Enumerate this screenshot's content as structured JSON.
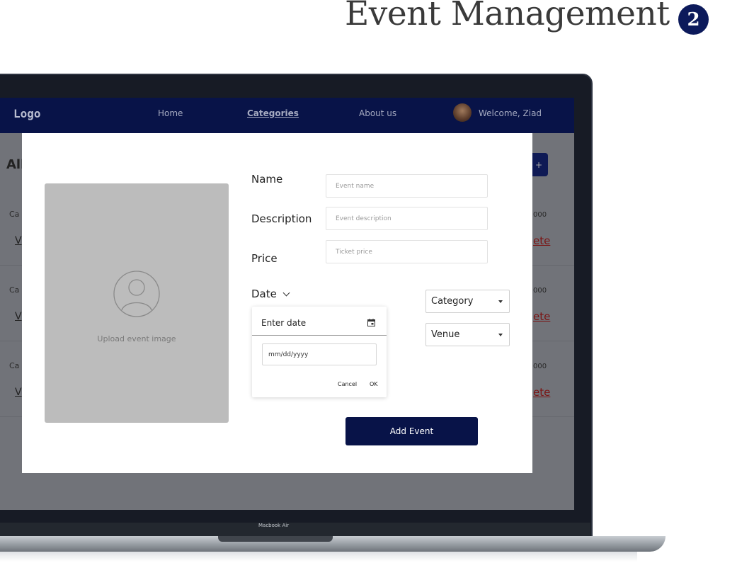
{
  "header": {
    "title": "Event Management",
    "step_number": "2"
  },
  "laptop": {
    "model_label": "Macbook Air"
  },
  "nav": {
    "logo": "Logo",
    "links": [
      {
        "label": "Home",
        "active": false
      },
      {
        "label": "Categories",
        "active": true
      },
      {
        "label": "About us",
        "active": false
      }
    ],
    "welcome": "Welcome, Ziad"
  },
  "background_page": {
    "title_fragment": "All",
    "add_button_fragment": "+",
    "rows": [
      {
        "left_label": "Ca",
        "left_link": "V",
        "right_value": "000",
        "right_link": "ete"
      },
      {
        "left_label": "Ca",
        "left_link": "V",
        "right_value": "000",
        "right_link": "ete"
      },
      {
        "left_label": "Ca",
        "left_link": "V",
        "right_value": "000",
        "right_link": "ete"
      }
    ]
  },
  "modal": {
    "upload": {
      "label": "Upload event image"
    },
    "fields": {
      "name": {
        "label": "Name",
        "placeholder": "Event name",
        "value": ""
      },
      "description": {
        "label": "Description",
        "placeholder": "Event description",
        "value": ""
      },
      "price": {
        "label": "Price",
        "placeholder": "Ticket price",
        "value": ""
      }
    },
    "date": {
      "label": "Date",
      "picker": {
        "title": "Enter date",
        "placeholder": "mm/dd/yyyy",
        "cancel": "Cancel",
        "ok": "OK"
      }
    },
    "selects": {
      "category": {
        "selected": "Category"
      },
      "venue": {
        "selected": "Venue"
      }
    },
    "submit_label": "Add Event"
  },
  "colors": {
    "navy": "#081348",
    "badge": "#0c1a5b",
    "delete_link": "#7a1515"
  }
}
